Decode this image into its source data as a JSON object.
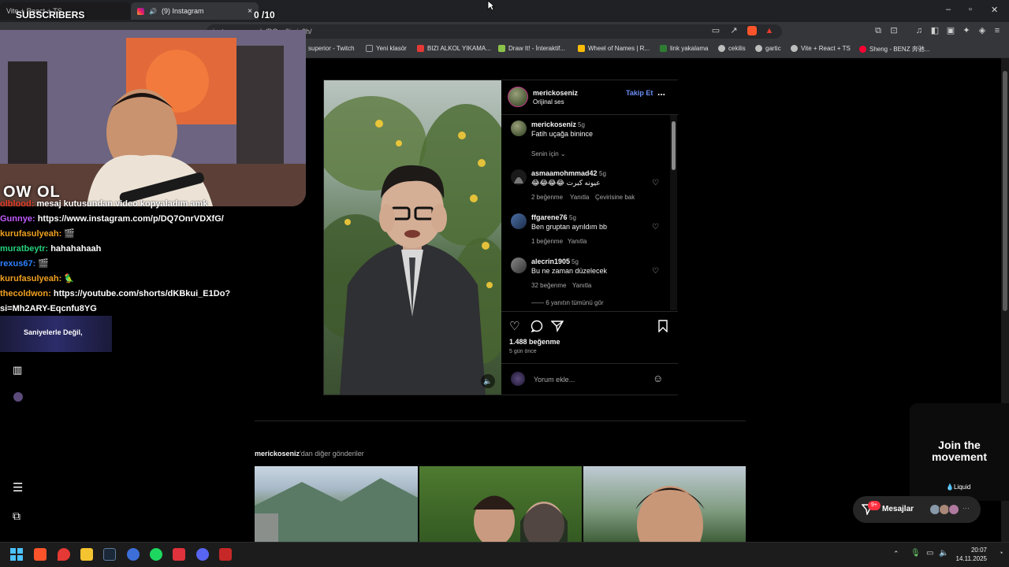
{
  "stream_overlay": {
    "subscribers_label": "SUBSCRIBERS",
    "counter_current": "0",
    "counter_total": "/10",
    "logo_text": "OW OL",
    "banner_text": "Saniyelerle Değil,",
    "chat": [
      {
        "user": "olblood:",
        "user_color": "#e8402a",
        "message": "mesaj kutusundan video kopyaladım amk"
      },
      {
        "user": "Gunnye:",
        "user_color": "#c15bff",
        "message": "https://www.instagram.com/p/DQ7OnrVDXfG/"
      },
      {
        "user": "kurufasulyeah:",
        "user_color": "#f0a020",
        "message": "🎬"
      },
      {
        "user": "muratbeytr:",
        "user_color": "#26d07c",
        "message": "hahahahaah"
      },
      {
        "user": "rexus67:",
        "user_color": "#2f80ff",
        "message": "🎬"
      },
      {
        "user": "kurufasulyeah:",
        "user_color": "#f0a020",
        "message": "🦜"
      },
      {
        "user": "thecoldwon:",
        "user_color": "#f0a020",
        "message": "https://youtube.com/shorts/dKBkui_E1Do?"
      },
      {
        "user": "",
        "user_color": "#ffffff",
        "message": "si=Mh2ARY-Eqcnfu8YG"
      }
    ]
  },
  "browser": {
    "tabs": [
      {
        "label": "Vite + React + TS"
      },
      {
        "label": "(9) Instagram"
      }
    ],
    "url": "instagram.com/p/DQzn0imjc3h/",
    "bookmarks": [
      {
        "label": "superior - Twitch",
        "color": "#9146ff"
      },
      {
        "label": "Yeni klasör",
        "color": "#9aa0a6"
      },
      {
        "label": "BIZI ALKOL YIKAMA...",
        "color": "#e53935"
      },
      {
        "label": "Draw It! - İnteraktif...",
        "color": "#8bc34a"
      },
      {
        "label": "Wheel of Names | R...",
        "color": "#fbbc04"
      },
      {
        "label": "link yakalama",
        "color": "#2e7d32"
      },
      {
        "label": "cekilis",
        "color": "#bdbdbd"
      },
      {
        "label": "gartic",
        "color": "#bdbdbd"
      },
      {
        "label": "Vite + React + TS",
        "color": "#bdbdbd"
      },
      {
        "label": "Sheng - BENZ 奔驰...",
        "color": "#ff0033"
      }
    ]
  },
  "post": {
    "username": "merickoseniz",
    "audio": "Orijinal ses",
    "follow_label": "Takip Et",
    "more_label": "...",
    "caption": {
      "user": "merickoseniz",
      "time": "5g",
      "text": "Fatih uçağa binince"
    },
    "sort_label": "Senin için",
    "comments": [
      {
        "user": "asmaamohmmad42",
        "time": "5g",
        "text": "😂😂😂😂 عيونه كبرت",
        "likes": "2 beğenme",
        "reply": "Yanıtla",
        "translate": "Çevirisine bak"
      },
      {
        "user": "ffgarene76",
        "time": "5g",
        "text": "Ben gruptan ayrıldım bb",
        "likes": "1 beğenme",
        "reply": "Yanıtla",
        "translate": ""
      },
      {
        "user": "alecrin1905",
        "time": "5g",
        "text": "Bu ne zaman düzelecek",
        "likes": "32 beğenme",
        "reply": "Yanıtla",
        "translate": ""
      }
    ],
    "view_replies": "6 yanıtın tümünü gör",
    "likes": "1.488 beğenme",
    "posted": "5 gün önce",
    "comment_placeholder": "Yorum ekle..."
  },
  "more_posts": {
    "username": "merickoseniz",
    "suffix": "'dan diğer gönderiler"
  },
  "side_ad": {
    "headline": "Join the movement",
    "brand": "Liquid"
  },
  "messages": {
    "label": "Mesajlar",
    "badge": "9+"
  },
  "taskbar": {
    "time": "20:07",
    "date": "14.11.2025"
  }
}
